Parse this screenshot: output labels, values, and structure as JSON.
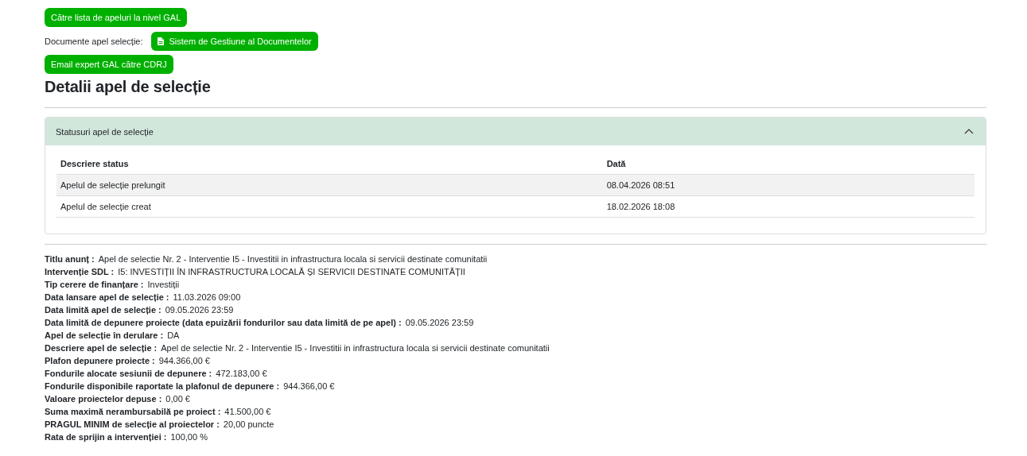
{
  "top_button": "Către lista de apeluri la nivel GAL",
  "documents": {
    "label": "Documente apel selecție:",
    "button": "Sistem de Gestiune al Documentelor"
  },
  "email_button": "Email expert GAL către CDRJ",
  "heading": "Detalii apel de selecție",
  "accordion": {
    "title": "Statusuri apel de selecție",
    "expanded": true,
    "columns": [
      "Descriere status",
      "Dată"
    ],
    "rows": [
      {
        "cells": [
          "Apelul de selecție prelungit",
          "08.04.2026 08:51"
        ]
      },
      {
        "cells": [
          "Apelul de selecție creat",
          "18.02.2026 18:08"
        ]
      }
    ]
  },
  "details": [
    {
      "label": "Titlu anunț :",
      "value": "Apel de selectie Nr. 2 - Interventie I5 - Investitii in infrastructura locala si servicii destinate comunitatii"
    },
    {
      "label": "Intervenție SDL :",
      "value": "I5: INVESTIȚII ÎN INFRASTRUCTURA LOCALĂ ȘI SERVICII DESTINATE COMUNITĂȚII"
    },
    {
      "label": "Tip cerere de finanțare :",
      "value": "Investiții"
    },
    {
      "label": "Data lansare apel de selecție :",
      "value": "11.03.2026 09:00"
    },
    {
      "label": "Data limită apel de selecție :",
      "value": "09.05.2026 23:59"
    },
    {
      "label": "Data limită de depunere proiecte (data epuizării fondurilor sau data limită de pe apel) :",
      "value": "09.05.2026 23:59"
    },
    {
      "label": "Apel de selecție în derulare :",
      "value": "DA"
    },
    {
      "label": "Descriere apel de selecție :",
      "value": "Apel de selectie Nr. 2 - Interventie I5 - Investitii in infrastructura locala si servicii destinate comunitatii"
    },
    {
      "label": "Plafon depunere proiecte :",
      "value": "944.366,00 €"
    },
    {
      "label": "Fondurile alocate sesiunii de depunere :",
      "value": "472.183,00 €"
    },
    {
      "label": "Fondurile disponibile raportate la plafonul de depunere :",
      "value": "944.366,00 €"
    },
    {
      "label": "Valoare proiectelor depuse :",
      "value": "0,00 €"
    },
    {
      "label": "Suma maximă nerambursabilă pe proiect :",
      "value": "41.500,00 €"
    },
    {
      "label": "PRAGUL MINIM de selecție al proiectelor :",
      "value": "20,00 puncte"
    },
    {
      "label": "Rata de sprijin a intervenției :",
      "value": "100,00 %"
    }
  ]
}
